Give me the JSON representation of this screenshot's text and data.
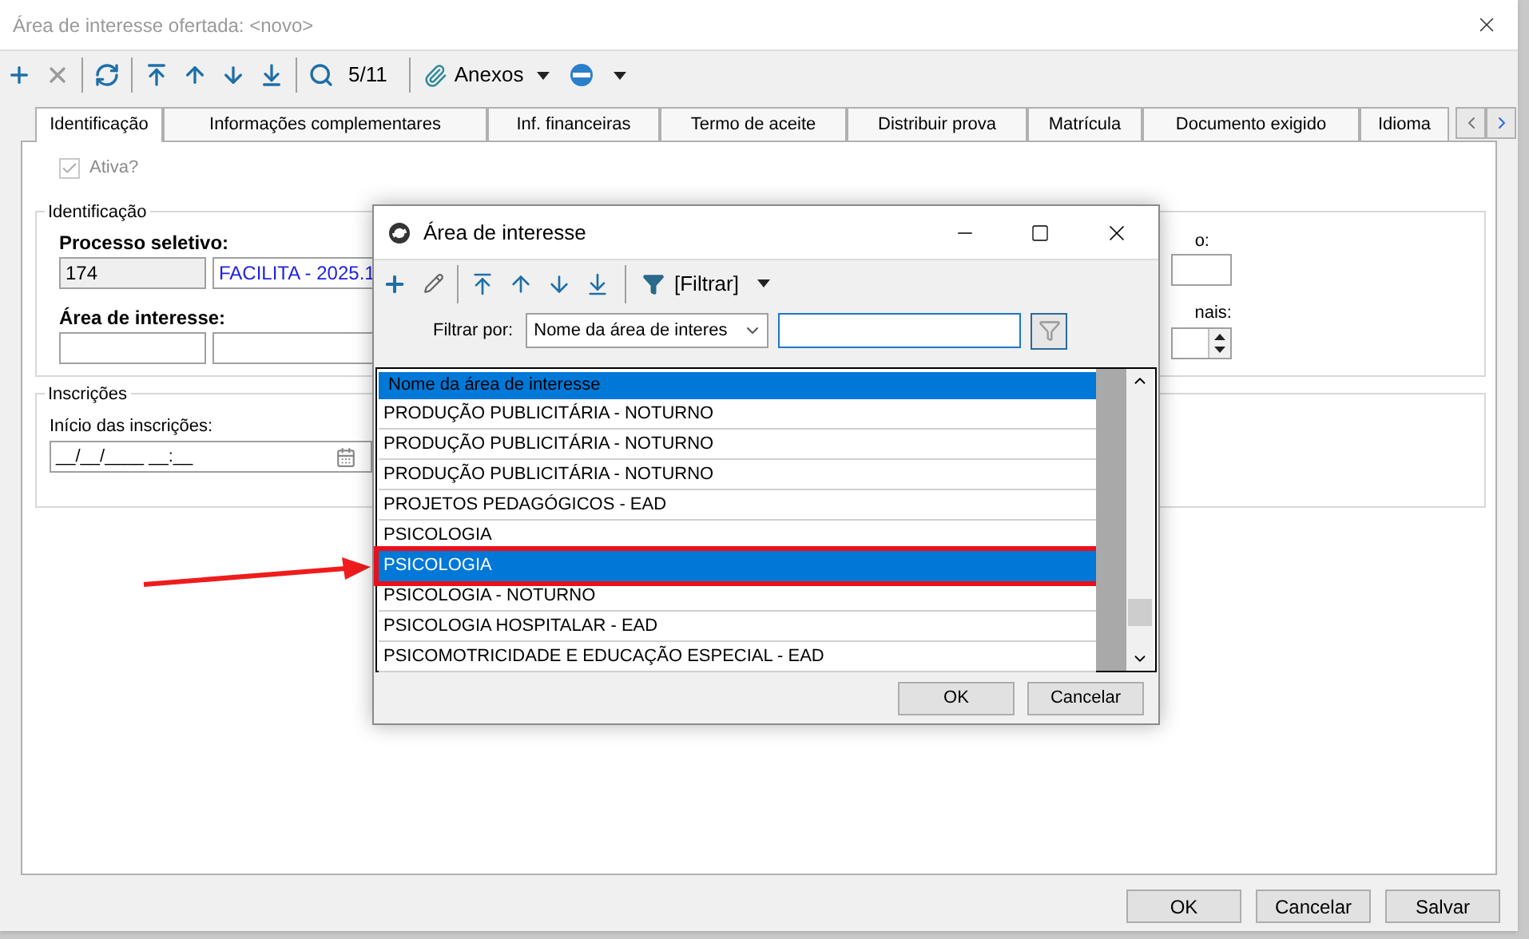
{
  "window": {
    "title": "Área de interesse ofertada: <novo>"
  },
  "toolbar": {
    "items": [
      {
        "kind": "add",
        "disabled": false
      },
      {
        "kind": "delete",
        "disabled": true
      },
      {
        "kind": "sep"
      },
      {
        "kind": "refresh",
        "disabled": false
      },
      {
        "kind": "sep"
      },
      {
        "kind": "first",
        "disabled": false
      },
      {
        "kind": "prev",
        "disabled": false
      },
      {
        "kind": "next",
        "disabled": false
      },
      {
        "kind": "last",
        "disabled": false
      },
      {
        "kind": "sep"
      },
      {
        "kind": "search",
        "disabled": false
      }
    ],
    "record_counter": "5/11",
    "attachments_button": "Anexos"
  },
  "tabs": [
    {
      "label": "Identificação",
      "selected": true
    },
    {
      "label": "Informações complementares",
      "selected": false
    },
    {
      "label": "Inf. financeiras",
      "selected": false
    },
    {
      "label": "Termo de aceite",
      "selected": false
    },
    {
      "label": "Distribuir prova",
      "selected": false
    },
    {
      "label": "Matrícula",
      "selected": false
    },
    {
      "label": "Documento exigido",
      "selected": false
    },
    {
      "label": "Idioma",
      "selected": false
    }
  ],
  "active_checkbox": {
    "label": "Ativa?",
    "checked": true,
    "disabled": true
  },
  "identificacao": {
    "legend": "Identificação",
    "processo_label": "Processo seletivo:",
    "processo_code": "174",
    "processo_name": "FACILITA - 2025.1",
    "area_label": "Área de interesse:",
    "right_label_1": "o:",
    "right_label_2": "nais:"
  },
  "inscricoes": {
    "legend": "Inscrições",
    "start_label": "Início das inscrições:",
    "start_value": "__/__/____ __:__"
  },
  "dialog": {
    "title": "Área de interesse",
    "filter_button": "[Filtrar]",
    "filter_label": "Filtrar por:",
    "filter_field": "Nome da área de interes",
    "list_header": "Nome da área de interesse",
    "rows": [
      {
        "name": "PRODUÇÃO PUBLICITÁRIA - NOTURNO",
        "selected": false
      },
      {
        "name": "PRODUÇÃO PUBLICITÁRIA - NOTURNO",
        "selected": false
      },
      {
        "name": "PRODUÇÃO PUBLICITÁRIA - NOTURNO",
        "selected": false
      },
      {
        "name": "PROJETOS PEDAGÓGICOS - EAD",
        "selected": false
      },
      {
        "name": "PSICOLOGIA",
        "selected": false
      },
      {
        "name": "PSICOLOGIA",
        "selected": true
      },
      {
        "name": "PSICOLOGIA - NOTURNO",
        "selected": false
      },
      {
        "name": "PSICOLOGIA HOSPITALAR - EAD",
        "selected": false
      },
      {
        "name": "PSICOMOTRICIDADE E EDUCAÇÃO ESPECIAL  - EAD",
        "selected": false
      }
    ],
    "buttons": [
      "OK",
      "Cancelar"
    ]
  },
  "buttons": [
    "OK",
    "Cancelar",
    "Salvar"
  ]
}
